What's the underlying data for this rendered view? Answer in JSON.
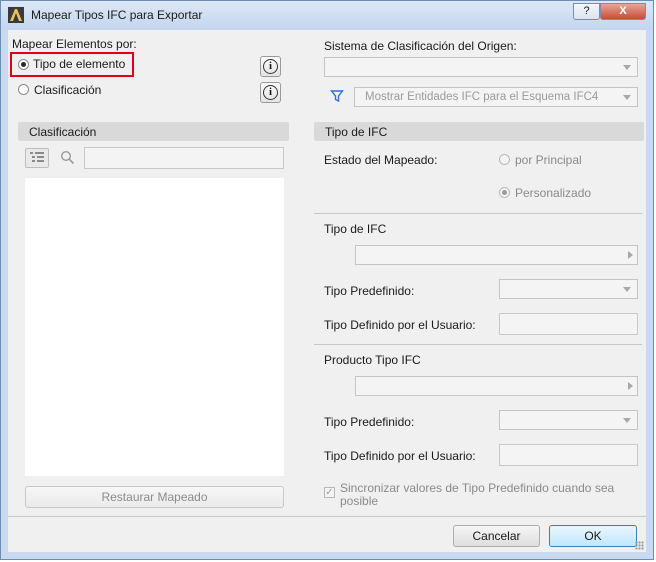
{
  "window": {
    "title": "Mapear Tipos IFC para Exportar",
    "help_label": "?",
    "close_label": "X",
    "app_icon": "archicad-app-icon"
  },
  "mapping": {
    "heading": "Mapear Elementos por:",
    "option_type": "Tipo de elemento",
    "option_classification": "Clasificación",
    "selected": "Tipo de elemento"
  },
  "source": {
    "heading": "Sistema de Clasificación del Origen:",
    "system_value": "",
    "filter_value": "Mostrar Entidades IFC para el Esquema IFC4"
  },
  "left_panel": {
    "header": "Clasificación",
    "search_placeholder": "",
    "restore_label": "Restaurar Mapeado"
  },
  "right_panel": {
    "header": "Tipo de IFC",
    "mapping_state_label": "Estado del Mapeado:",
    "by_main_label": "por Principal",
    "custom_label": "Personalizado",
    "ifc_type_heading": "Tipo de IFC",
    "ifc_type_value": "",
    "predefined_label_1": "Tipo Predefinido:",
    "user_defined_label_1": "Tipo Definido por el Usuario:",
    "product_heading": "Producto Tipo IFC",
    "product_value": "",
    "predefined_label_2": "Tipo Predefinido:",
    "user_defined_label_2": "Tipo Definido por el Usuario:",
    "sync_label_line1": "Sincronizar valores de Tipo Predefinido cuando sea",
    "sync_label_line2": "posible",
    "sync_checked": true
  },
  "footer": {
    "cancel_label": "Cancelar",
    "ok_label": "OK"
  },
  "colors": {
    "highlight": "#e0001b",
    "title_bar": "#c3d6ee",
    "filter_icon": "#2f6fd6"
  }
}
